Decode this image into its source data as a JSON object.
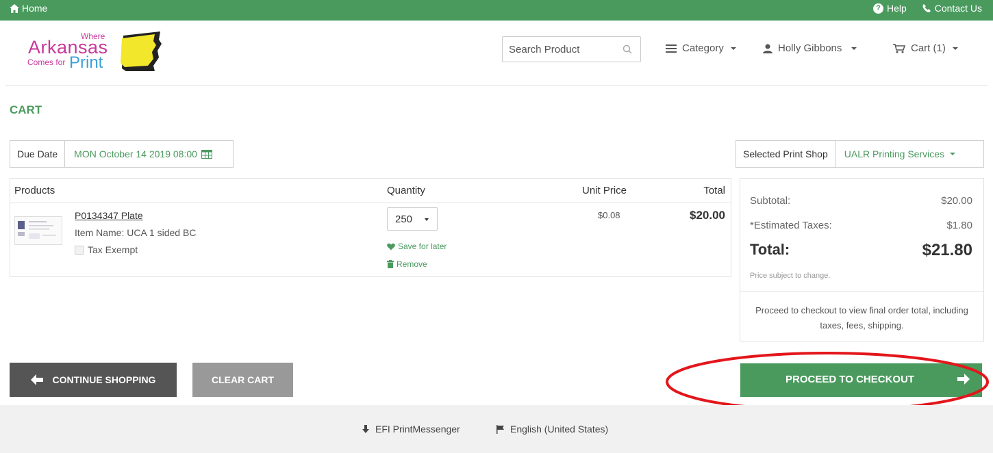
{
  "topbar": {
    "home": "Home",
    "help": "Help",
    "contact": "Contact Us"
  },
  "logo": {
    "where": "Where",
    "arkansas": "Arkansas",
    "comes_for": "Comes for",
    "print": "Print"
  },
  "header": {
    "search_placeholder": "Search Product",
    "category": "Category",
    "user": "Holly Gibbons",
    "cart": "Cart (1)"
  },
  "page_title": "CART",
  "due_date": {
    "label": "Due Date",
    "value": "MON October 14 2019 08:00"
  },
  "print_shop": {
    "label": "Selected Print Shop",
    "value": "UALR Printing Services"
  },
  "products_table": {
    "headers": {
      "products": "Products",
      "quantity": "Quantity",
      "unit_price": "Unit Price",
      "total": "Total"
    },
    "items": [
      {
        "code": "P0134347 Plate",
        "item_name": "Item Name: UCA 1 sided BC",
        "tax_exempt": "Tax Exempt",
        "quantity": "250",
        "save_for_later": "Save for later",
        "remove": "Remove",
        "unit_price": "$0.08",
        "total": "$20.00"
      }
    ]
  },
  "summary": {
    "subtotal_label": "Subtotal:",
    "subtotal_value": "$20.00",
    "taxes_label": "*Estimated Taxes:",
    "taxes_value": "$1.80",
    "total_label": "Total:",
    "total_value": "$21.80",
    "note": "Price subject to change.",
    "info": "Proceed to checkout to view final order total, including taxes, fees, shipping."
  },
  "buttons": {
    "continue": "CONTINUE SHOPPING",
    "clear": "CLEAR CART",
    "checkout": "PROCEED TO CHECKOUT"
  },
  "footer": {
    "messenger": "EFI PrintMessenger",
    "language": "English (United States)"
  },
  "colors": {
    "brand_green": "#4a9a5e",
    "logo_pink": "#c8379b",
    "logo_blue": "#3aa0d6",
    "annotation_red": "#e3161b"
  }
}
